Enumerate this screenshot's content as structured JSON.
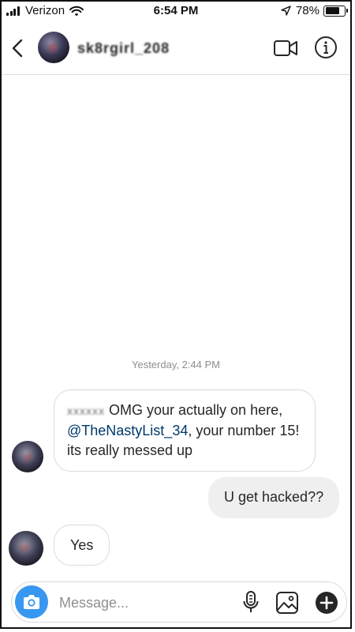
{
  "status_bar": {
    "carrier": "Verizon",
    "time": "6:54 PM",
    "battery": "78%",
    "battery_level": 0.78,
    "icons": [
      "signal-bars-icon",
      "wifi-icon",
      "location-arrow-icon",
      "battery-icon"
    ]
  },
  "header": {
    "username": "sk8rgirl_208",
    "icons": [
      "back-chevron-icon",
      "video-call-icon",
      "info-icon"
    ]
  },
  "chat": {
    "timestamp": "Yesterday, 2:44 PM",
    "messages": [
      {
        "from": "other",
        "sender_prefix": "xxxxxx",
        "text_before": " OMG your actually on here, ",
        "mention": "@TheNastyList_34",
        "text_after": ", your number 15!  its really messed up"
      },
      {
        "from": "me",
        "text": "U get hacked??"
      },
      {
        "from": "other",
        "text": "Yes"
      }
    ]
  },
  "composer": {
    "placeholder": "Message...",
    "icons": [
      "camera-icon",
      "microphone-icon",
      "gallery-icon",
      "plus-icon"
    ]
  },
  "colors": {
    "accent_blue": "#3897f0",
    "mention_blue": "#00376b",
    "bubble_out_bg": "#efefef",
    "border_gray": "#dbdbdb",
    "meta_gray": "#8e8e8e"
  }
}
